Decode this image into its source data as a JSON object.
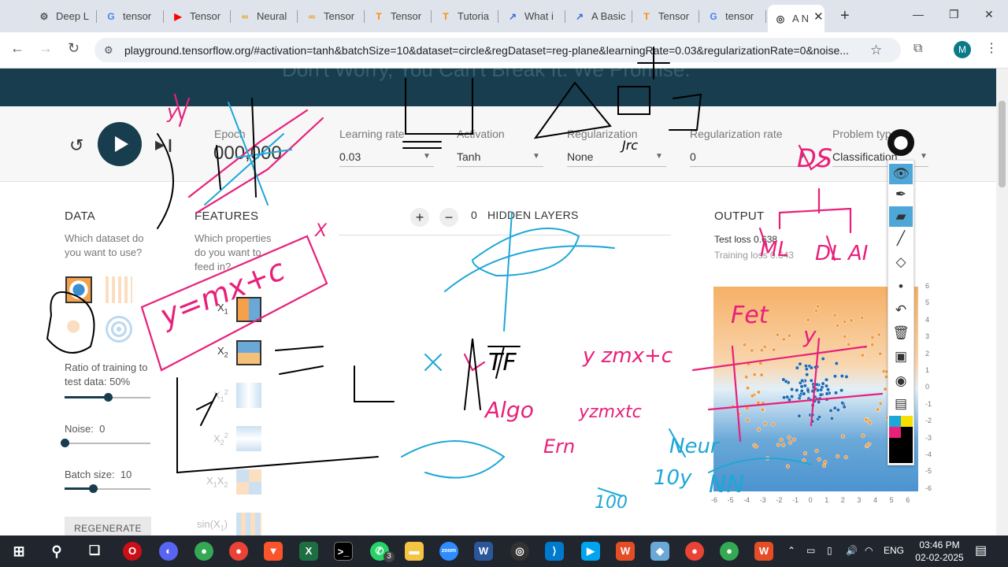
{
  "browser": {
    "tabs": [
      {
        "label": "Deep L",
        "icon": "gear-icon"
      },
      {
        "label": "tensor",
        "icon": "google-icon"
      },
      {
        "label": "Tensor",
        "icon": "youtube-icon"
      },
      {
        "label": "Neural",
        "icon": "link-icon"
      },
      {
        "label": "Tensor",
        "icon": "link-icon"
      },
      {
        "label": "Tensor",
        "icon": "tensorflow-icon"
      },
      {
        "label": "Tutoria",
        "icon": "tensorflow-icon"
      },
      {
        "label": "What i",
        "icon": "chart-icon"
      },
      {
        "label": "A Basic",
        "icon": "chart-icon"
      },
      {
        "label": "Tensor",
        "icon": "tensorflow-icon"
      },
      {
        "label": "tensor",
        "icon": "google-icon"
      },
      {
        "label": "A N",
        "icon": "target-icon"
      }
    ],
    "url": "playground.tensorflow.org/#activation=tanh&batchSize=10&dataset=circle&regDataset=reg-plane&learningRate=0.03&regularizationRate=0&noise...",
    "profile_initial": "M"
  },
  "banner": {
    "text": "Don't Worry, You Can't Break It. We Promise."
  },
  "controls": {
    "epoch_label": "Epoch",
    "epoch_value": "000,000",
    "learning_rate_label": "Learning rate",
    "learning_rate_value": "0.03",
    "activation_label": "Activation",
    "activation_value": "Tanh",
    "regularization_label": "Regularization",
    "regularization_value": "None",
    "regularization_rate_label": "Regularization rate",
    "regularization_rate_value": "0",
    "problem_type_label": "Problem type",
    "problem_type_value": "Classification"
  },
  "data_panel": {
    "heading": "DATA",
    "prompt": "Which dataset do you want to use?",
    "ratio_label": "Ratio of training to test data:",
    "ratio_value": "50%",
    "ratio_fraction": 0.5,
    "noise_label": "Noise:",
    "noise_value": "0",
    "noise_fraction": 0,
    "batch_label": "Batch size:",
    "batch_value": "10",
    "batch_fraction": 0.33,
    "regenerate_label": "REGENERATE"
  },
  "features_panel": {
    "heading": "FEATURES",
    "prompt": "Which properties do you want to feed in?",
    "features": [
      {
        "label": "X",
        "sub": "1",
        "active": true
      },
      {
        "label": "X",
        "sub": "2",
        "active": true
      },
      {
        "label": "X",
        "sub": "1",
        "sup": "2",
        "active": false
      },
      {
        "label": "X",
        "sub": "2",
        "sup": "2",
        "active": false
      },
      {
        "label": "X",
        "sub": "1",
        "label2": "X",
        "sub2": "2",
        "active": false
      },
      {
        "label": "sin(X",
        "sub": "1",
        "after": ")",
        "active": false
      }
    ]
  },
  "hidden_layers": {
    "count": "0",
    "label": "HIDDEN LAYERS",
    "add_symbol": "+",
    "remove_symbol": "−"
  },
  "output": {
    "heading": "OUTPUT",
    "test_loss_label": "Test loss",
    "test_loss_value": "0.638",
    "training_loss_label": "Training loss",
    "training_loss_value": "0.643",
    "x_ticks": [
      "-6",
      "-5",
      "-4",
      "-3",
      "-2",
      "-1",
      "0",
      "1",
      "2",
      "3",
      "4",
      "5",
      "6"
    ],
    "y_ticks": [
      "6",
      "5",
      "4",
      "3",
      "2",
      "1",
      "0",
      "-1",
      "-2",
      "-3",
      "-4",
      "-5",
      "-6"
    ]
  },
  "annotations": {
    "handwritten": [
      "y",
      "y=mx+c",
      "X",
      "Algo",
      "yzmxtc",
      "Ern",
      "Fet",
      "DS",
      "ML",
      "DL",
      "AI",
      "Neur",
      "10y",
      "NN",
      "100",
      "TF",
      "y",
      "y zmx+c",
      "Jrc"
    ]
  },
  "taskbar": {
    "time": "03:46 PM",
    "date": "02-02-2025",
    "lang": "ENG",
    "badge_count": "3"
  },
  "colors": {
    "dark": "#183d4e",
    "orange": "#f5a04a",
    "blue": "#3b8fd1",
    "pen_pink": "#e8207a",
    "pen_cyan": "#1ea7d6"
  }
}
